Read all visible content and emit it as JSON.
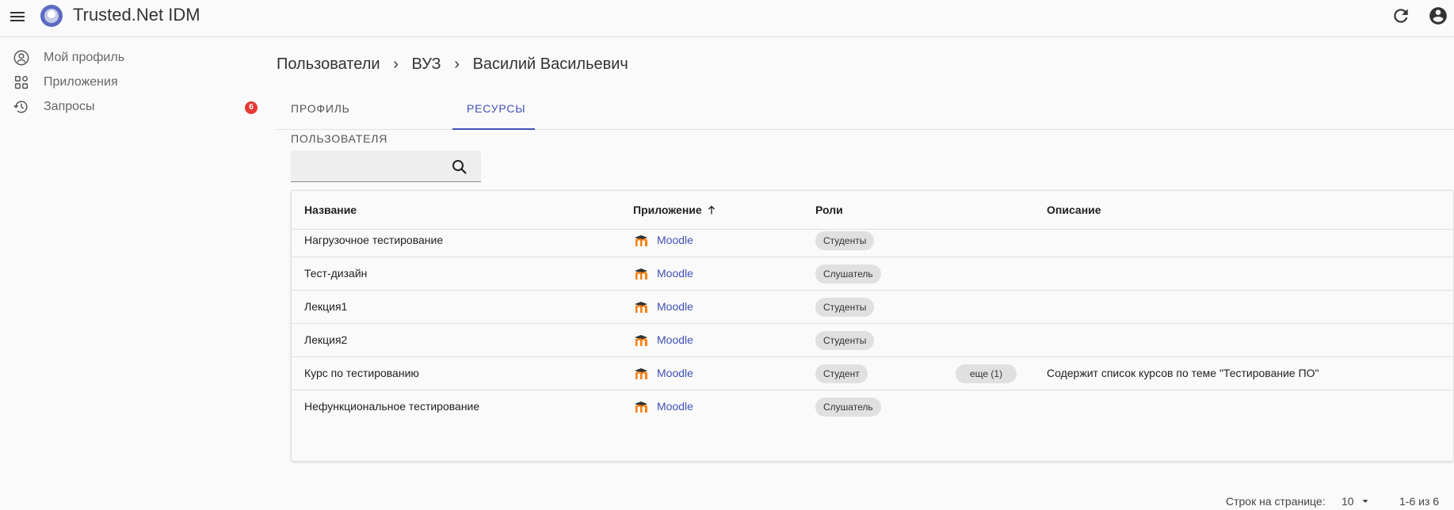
{
  "app": {
    "title": "Trusted.Net IDM",
    "brand_color": "#5c6bc0",
    "accent_color": "#3f51b5",
    "badge_color": "#e53935"
  },
  "topbar": {
    "menu_icon": "hamburger-menu-icon",
    "refresh_icon": "refresh-icon",
    "account_icon": "account-circle-icon"
  },
  "sidebar": {
    "items": [
      {
        "label": "Мой профиль",
        "icon": "account-circle-outline-icon"
      },
      {
        "label": "Приложения",
        "icon": "apps-grid-icon"
      },
      {
        "label": "Запросы",
        "icon": "history-icon",
        "badge": "6"
      }
    ]
  },
  "breadcrumb": {
    "items": [
      "Пользователи",
      "ВУЗ",
      "Василий Васильевич"
    ],
    "separator": "›"
  },
  "tabs": [
    {
      "label": "Профиль пользователя",
      "active": false
    },
    {
      "label": "Ресурсы",
      "active": true
    }
  ],
  "search": {
    "value": "",
    "placeholder": ""
  },
  "table": {
    "columns": [
      "Название",
      "Приложение",
      "Роли",
      "Описание"
    ],
    "sorted_column": "Приложение",
    "sort_direction": "asc",
    "rows": [
      {
        "name": "Нагрузочное тестирование",
        "app": "Moodle",
        "role": "Студенты",
        "more": "",
        "description": ""
      },
      {
        "name": "Тест-дизайн",
        "app": "Moodle",
        "role": "Слушатель",
        "more": "",
        "description": ""
      },
      {
        "name": "Лекция1",
        "app": "Moodle",
        "role": "Студенты",
        "more": "",
        "description": ""
      },
      {
        "name": "Лекция2",
        "app": "Moodle",
        "role": "Студенты",
        "more": "",
        "description": ""
      },
      {
        "name": "Курс по тестированию",
        "app": "Moodle",
        "role": "Студент",
        "more": "еще (1)",
        "description": "Содержит список курсов по теме \"Тестирование ПО\""
      },
      {
        "name": "Нефункциональное тестирование",
        "app": "Moodle",
        "role": "Слушатель",
        "more": "",
        "description": ""
      }
    ]
  },
  "pagination": {
    "rows_per_page_label": "Строк на странице:",
    "rows_per_page": "10",
    "range": "1-6 из 6"
  }
}
